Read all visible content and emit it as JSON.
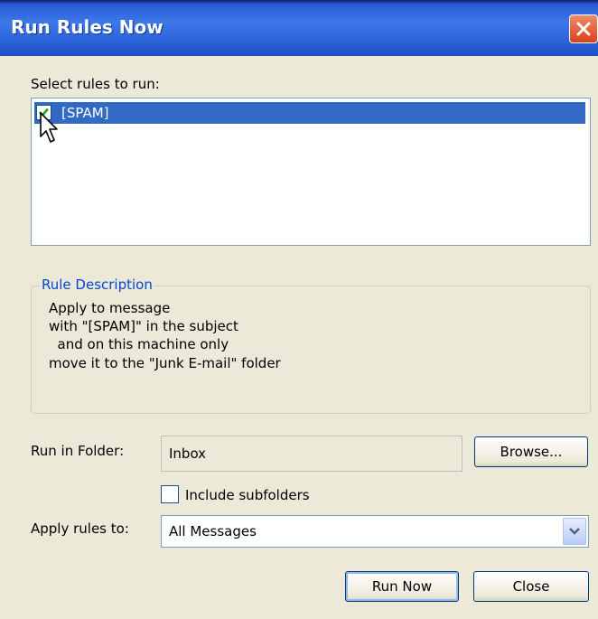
{
  "window": {
    "title": "Run Rules Now"
  },
  "rules": {
    "label": "Select rules to run:",
    "items": [
      {
        "name": "[SPAM]",
        "checked": true,
        "selected": true
      }
    ]
  },
  "description": {
    "title": "Rule Description",
    "lines": [
      "Apply to message",
      "with \"[SPAM]\" in the subject",
      "  and on this machine only",
      "move it to the \"Junk E-mail\" folder"
    ]
  },
  "folder": {
    "label": "Run in Folder:",
    "value": "Inbox",
    "browse_label": "Browse...",
    "include_subfolders_label": "Include subfolders",
    "include_subfolders_checked": false
  },
  "apply": {
    "label": "Apply rules to:",
    "value": "All Messages"
  },
  "buttons": {
    "run_now": "Run Now",
    "close": "Close"
  },
  "icons": {
    "close": "close-icon",
    "check": "checkmark-icon",
    "dropdown": "chevron-down-icon",
    "cursor": "mouse-pointer-icon"
  },
  "colors": {
    "titlebar": "#2a62da",
    "selection": "#316ac5",
    "group_title": "#0046d5",
    "background": "#ece9d8"
  }
}
